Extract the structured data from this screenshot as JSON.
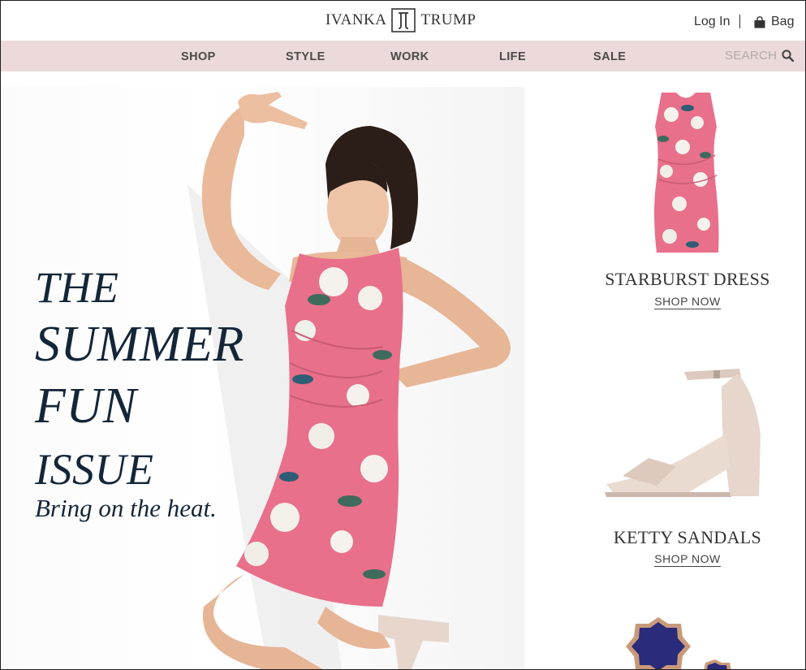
{
  "header": {
    "brand_left": "IVANKA",
    "brand_right": "TRUMP",
    "login_label": "Log In",
    "bag_label": "Bag"
  },
  "nav": {
    "items": [
      {
        "label": "SHOP"
      },
      {
        "label": "STYLE"
      },
      {
        "label": "WORK"
      },
      {
        "label": "LIFE"
      },
      {
        "label": "SALE"
      }
    ],
    "search_label": "SEARCH"
  },
  "hero": {
    "title_lines": [
      "THE",
      "SUMMER",
      "FUN",
      "ISSUE"
    ],
    "subtitle": "Bring on the heat."
  },
  "products": [
    {
      "name": "STARBURST DRESS",
      "cta": "SHOP NOW"
    },
    {
      "name": "KETTY SANDALS",
      "cta": "SHOP NOW"
    }
  ],
  "colors": {
    "nav_bg": "#ecd9d9",
    "headline": "#142638",
    "dress_pink": "#e8708a",
    "sandal_nude": "#e6d6cc",
    "jewel_navy": "#2a2b7a"
  },
  "icons": {
    "logo": "ij-monogram-icon",
    "bag": "shopping-bag-icon",
    "search": "search-icon"
  }
}
